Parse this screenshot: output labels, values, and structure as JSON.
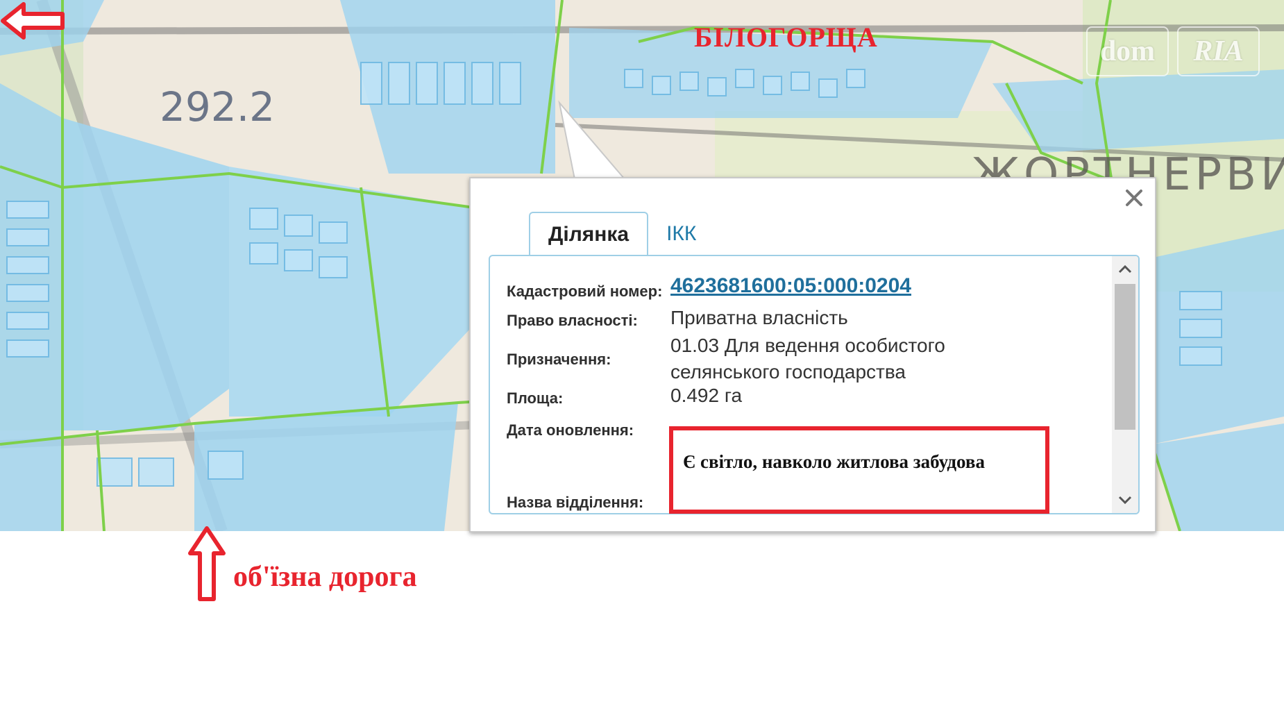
{
  "map": {
    "place_label": "БІЛОГОРЩА",
    "bypass_label": "об'їзна дорога",
    "elevation_label": "292.2",
    "area_text": "ЖОРТНЕРВИ"
  },
  "watermark": {
    "left": "dom",
    "right": "RIA"
  },
  "popup": {
    "tabs": [
      "Ділянка",
      "ІКК"
    ],
    "active_tab": "Ділянка",
    "fields": {
      "cadastral_label": "Кадастровий номер:",
      "cadastral_value": "4623681600:05:000:0204",
      "ownership_label": "Право власності:",
      "ownership_value": "Приватна власність",
      "purpose_label": "Призначення:",
      "purpose_value_line1": "01.03 Для ведення особистого",
      "purpose_value_line2": "селянського господарства",
      "area_label": "Площа:",
      "area_value": "0.492 га",
      "update_label": "Дата оновлення:",
      "department_label": "Назва відділення:"
    }
  },
  "note": "Є світло, навколо житлова забудова",
  "colors": {
    "annotation_red": "#e8242e",
    "parcel_fill": "#8fd0f5",
    "boundary_green": "#7ed04a",
    "link_blue": "#1f6f9c"
  }
}
